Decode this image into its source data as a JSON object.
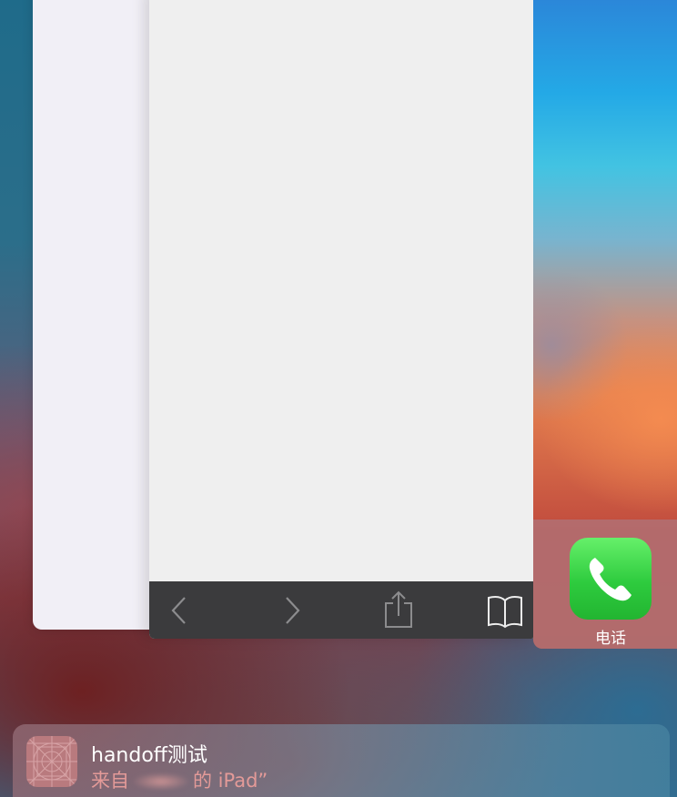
{
  "app_switcher": {
    "cards": [
      {
        "name": "background-app-card"
      },
      {
        "name": "safari-app-card"
      },
      {
        "name": "home-screen-card"
      }
    ]
  },
  "home_screen": {
    "dock_app_label": "电话",
    "dock_app_icon": "phone-icon"
  },
  "safari": {
    "toolbar": {
      "back_icon": "chevron-left-icon",
      "forward_icon": "chevron-right-icon",
      "share_icon": "share-icon",
      "bookmarks_icon": "book-icon"
    }
  },
  "handoff": {
    "title": "handoff测试",
    "subtitle_prefix": "来自",
    "subtitle_suffix": "的 iPad”",
    "icon": "app-placeholder-icon"
  },
  "colors": {
    "phone_green": "#2ecb3e",
    "toolbar_bg": "#3b3b3d",
    "subtitle_text": "#e39a98"
  }
}
